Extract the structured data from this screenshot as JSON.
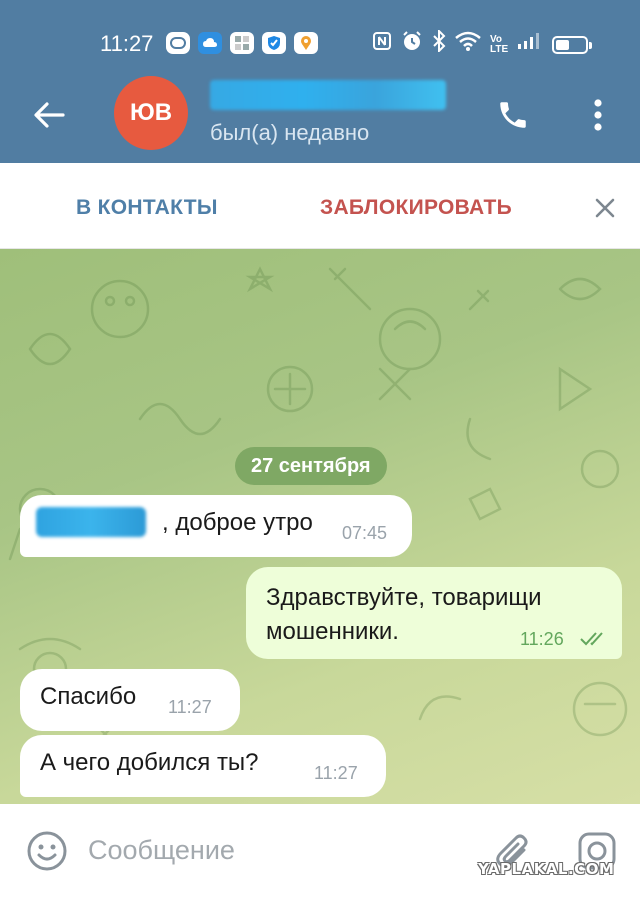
{
  "status_bar": {
    "time": "11:27",
    "network_label": "Vo\nLTE",
    "battery_level": 0.45
  },
  "header": {
    "avatar_initials": "ЮВ",
    "contact_name": "",
    "contact_status": "был(а) недавно"
  },
  "action_bar": {
    "add_contact_label": "В КОНТАКТЫ",
    "block_label": "ЗАБЛОКИРОВАТЬ"
  },
  "chat": {
    "date_label": "27 сентября",
    "messages": [
      {
        "direction": "incoming",
        "text": ", доброе утро",
        "time": "07:45"
      },
      {
        "direction": "outgoing",
        "text": "Здравствуйте, товарищи мошенники.",
        "time": "11:26",
        "read": true
      },
      {
        "direction": "incoming",
        "text": "Спасибо",
        "time": "11:27"
      },
      {
        "direction": "incoming",
        "text": "А чего добился ты?",
        "time": "11:27"
      }
    ]
  },
  "input_bar": {
    "placeholder": "Сообщение"
  },
  "watermark": "YAPLAKAL.COM",
  "colors": {
    "header": "#517da2",
    "avatar": "#e75a3f",
    "add_contact": "#4f7fa8",
    "block": "#c4534f",
    "outgoing_bubble": "#eefed9",
    "date_chip": "#7fa864"
  }
}
